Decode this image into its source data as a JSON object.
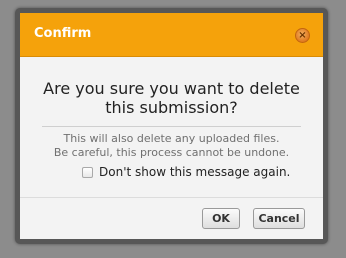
{
  "dialog": {
    "title": "Confirm",
    "close_symbol": "×",
    "close_icon": "close-icon",
    "question_line1": "Are you sure you want to delete",
    "question_line2": "this submission?",
    "warning_line1": "This will also delete any uploaded files.",
    "warning_line2": "Be careful, this process cannot be undone.",
    "dont_show_label": "Don't show this message again.",
    "dont_show_checked": false,
    "ok_label": "OK",
    "cancel_label": "Cancel"
  },
  "colors": {
    "titlebar": "#f5a20b",
    "close_button": "#e07a20",
    "dialog_background": "#f3f3f3",
    "frame": "#575757",
    "backdrop": "#8c8c8c"
  }
}
